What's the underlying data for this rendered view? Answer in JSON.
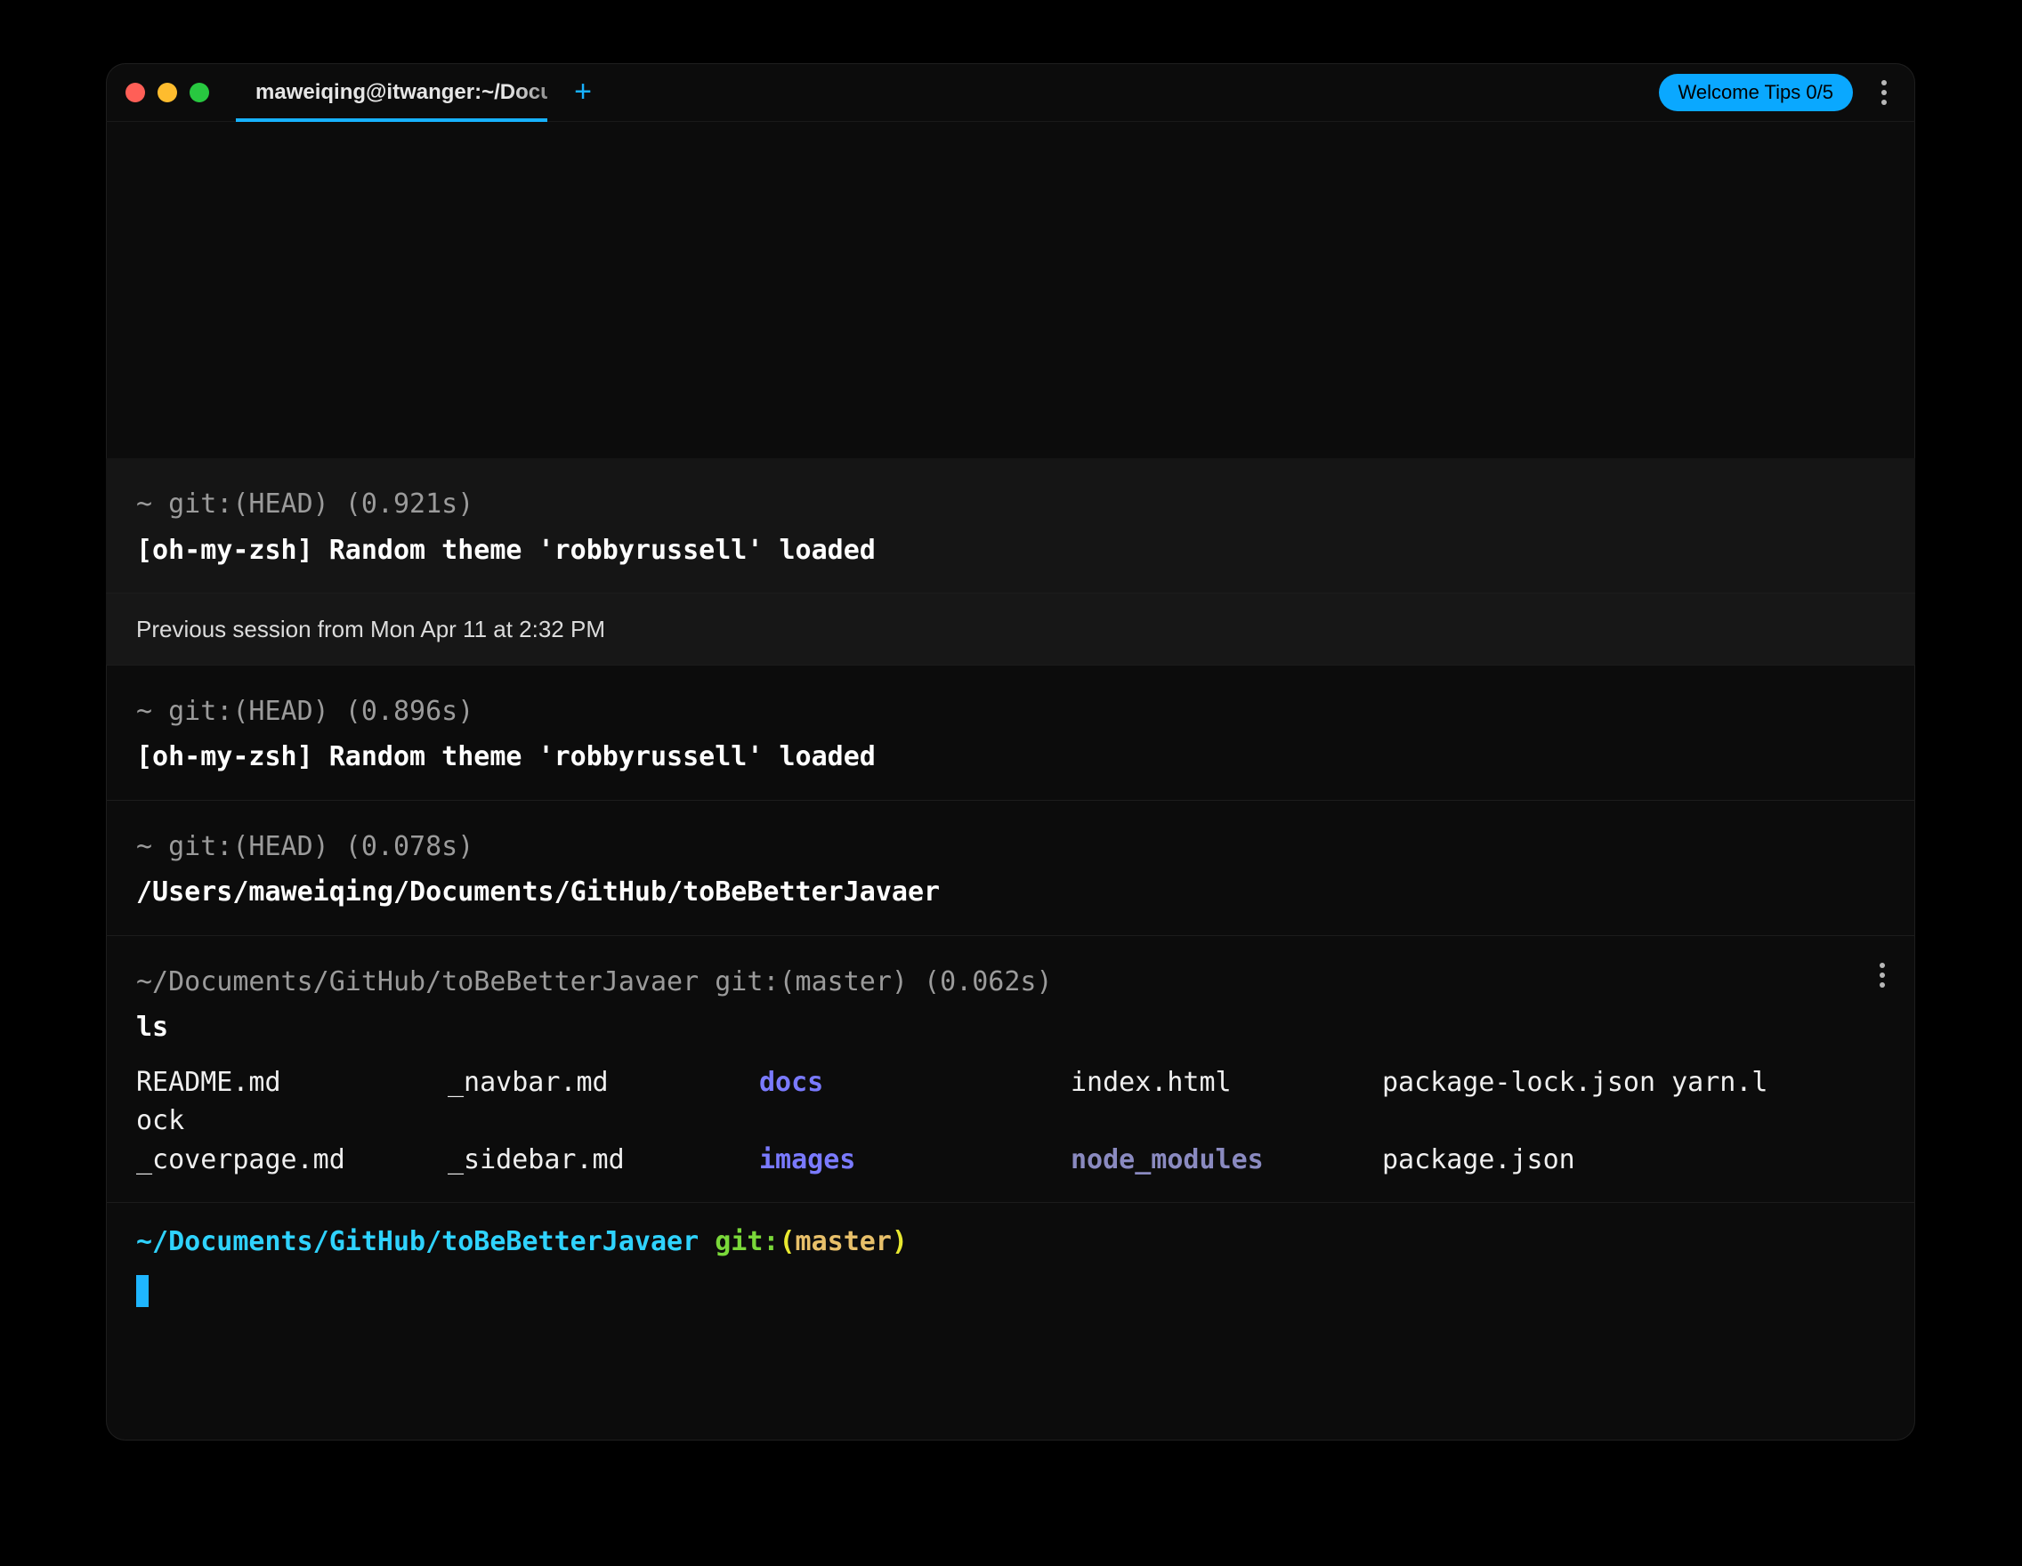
{
  "titlebar": {
    "tab_label": "maweiqing@itwanger:~/Documents",
    "new_tab_glyph": "+",
    "welcome_tips_label": "Welcome Tips 0/5"
  },
  "blocks": {
    "b1": {
      "prompt": "~ git:(HEAD) (0.921s)",
      "output": "[oh-my-zsh] Random theme 'robbyrussell' loaded"
    },
    "session_notice": "Previous session from Mon Apr 11 at 2:32 PM",
    "b2": {
      "prompt": "~ git:(HEAD) (0.896s)",
      "output": "[oh-my-zsh] Random theme 'robbyrussell' loaded"
    },
    "b3": {
      "prompt": "~ git:(HEAD) (0.078s)",
      "output": "/Users/maweiqing/Documents/GitHub/toBeBetterJavaer"
    },
    "b4": {
      "prompt": "~/Documents/GitHub/toBeBetterJavaer git:(master) (0.062s)",
      "command": "ls",
      "row1": {
        "c1": "README.md",
        "c2": "_navbar.md",
        "c3": "docs",
        "c4": "index.html",
        "c5": "package-lock.json yarn.l"
      },
      "row1_wrap": "ock",
      "row2": {
        "c1": "_coverpage.md",
        "c2": "_sidebar.md",
        "c3": "images",
        "c4": "node_modules",
        "c5": "package.json"
      }
    },
    "live": {
      "path": "~/Documents/GitHub/toBeBetterJavaer",
      "git_word": " git:",
      "paren_open": "(",
      "branch": "master",
      "paren_close": ")"
    }
  }
}
